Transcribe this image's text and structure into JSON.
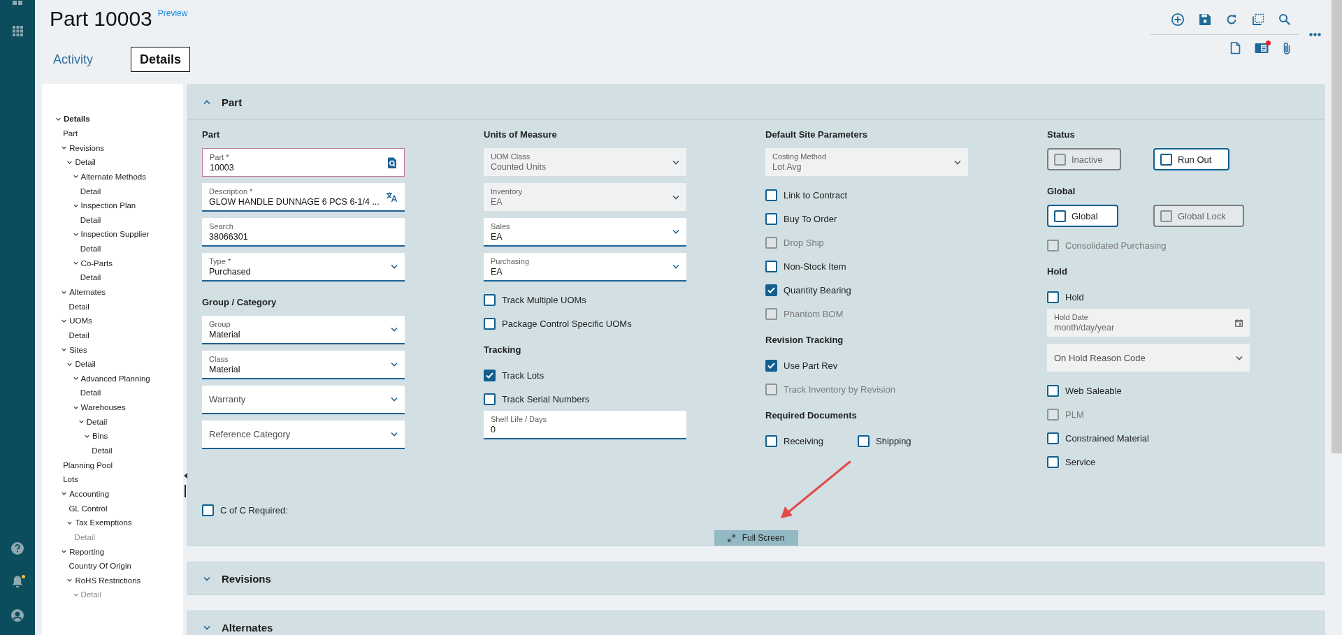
{
  "rail": {
    "unread": true
  },
  "header": {
    "title": "Part 10003",
    "preview_link": "Preview"
  },
  "tabs": [
    {
      "label": "Activity",
      "selected": false
    },
    {
      "label": "Details",
      "selected": true
    }
  ],
  "toolbar": {
    "badge": true
  },
  "tree": [
    {
      "label": "Details",
      "expanded": true,
      "disabled": false,
      "children": [
        {
          "label": "Part",
          "expanded": false,
          "disabled": false
        },
        {
          "label": "Revisions",
          "expanded": true,
          "disabled": false,
          "children": [
            {
              "label": "Detail",
              "expanded": true,
              "disabled": false,
              "children": [
                {
                  "label": "Alternate Methods",
                  "expanded": true,
                  "disabled": false,
                  "children": [
                    {
                      "label": "Detail",
                      "expanded": false,
                      "disabled": false
                    }
                  ]
                },
                {
                  "label": "Inspection Plan",
                  "expanded": true,
                  "disabled": false,
                  "children": [
                    {
                      "label": "Detail",
                      "expanded": false,
                      "disabled": false
                    }
                  ]
                },
                {
                  "label": "Inspection Supplier",
                  "expanded": true,
                  "disabled": false,
                  "children": [
                    {
                      "label": "Detail",
                      "expanded": false,
                      "disabled": false
                    }
                  ]
                },
                {
                  "label": "Co-Parts",
                  "expanded": true,
                  "disabled": false,
                  "children": [
                    {
                      "label": "Detail",
                      "expanded": false,
                      "disabled": false
                    }
                  ]
                }
              ]
            }
          ]
        },
        {
          "label": "Alternates",
          "expanded": true,
          "disabled": false,
          "children": [
            {
              "label": "Detail",
              "expanded": false,
              "disabled": false
            }
          ]
        },
        {
          "label": "UOMs",
          "expanded": true,
          "disabled": false,
          "children": [
            {
              "label": "Detail",
              "expanded": false,
              "disabled": false
            }
          ]
        },
        {
          "label": "Sites",
          "expanded": true,
          "disabled": false,
          "children": [
            {
              "label": "Detail",
              "expanded": true,
              "disabled": false,
              "children": [
                {
                  "label": "Advanced Planning",
                  "expanded": true,
                  "disabled": false,
                  "children": [
                    {
                      "label": "Detail",
                      "expanded": false,
                      "disabled": false
                    }
                  ]
                },
                {
                  "label": "Warehouses",
                  "expanded": true,
                  "disabled": false,
                  "children": [
                    {
                      "label": "Detail",
                      "expanded": true,
                      "disabled": false,
                      "children": [
                        {
                          "label": "Bins",
                          "expanded": true,
                          "disabled": false,
                          "children": [
                            {
                              "label": "Detail",
                              "expanded": false,
                              "disabled": false
                            }
                          ]
                        }
                      ]
                    }
                  ]
                }
              ]
            }
          ]
        },
        {
          "label": "Planning Pool",
          "expanded": false,
          "disabled": false
        },
        {
          "label": "Lots",
          "expanded": false,
          "disabled": false
        },
        {
          "label": "Accounting",
          "expanded": true,
          "disabled": false,
          "children": [
            {
              "label": "GL Control",
              "expanded": false,
              "disabled": false
            },
            {
              "label": "Tax Exemptions",
              "expanded": true,
              "disabled": false,
              "children": [
                {
                  "label": "Detail",
                  "expanded": false,
                  "disabled": true
                }
              ]
            }
          ]
        },
        {
          "label": "Reporting",
          "expanded": true,
          "disabled": false,
          "children": [
            {
              "label": "Country Of Origin",
              "expanded": false,
              "disabled": false
            },
            {
              "label": "RoHS Restrictions",
              "expanded": true,
              "disabled": false,
              "children": [
                {
                  "label": "Detail",
                  "expanded": true,
                  "disabled": true
                }
              ]
            }
          ]
        }
      ]
    }
  ],
  "part_section": {
    "title": "Part",
    "expanded": true,
    "columns": [
      {
        "items": [
          {
            "kind": "heading",
            "text": "Part"
          },
          {
            "kind": "lookup",
            "label": "Part *",
            "value": "10003",
            "focused": true
          },
          {
            "kind": "translatable",
            "label": "Description *",
            "value": "GLOW HANDLE DUNNAGE 6 PCS 6-1/4 ...",
            "focused": false
          },
          {
            "kind": "text",
            "label": "Search",
            "value": "38066301",
            "focused": false
          },
          {
            "kind": "select",
            "label": "Type *",
            "value": "Purchased",
            "disabled": false
          },
          {
            "kind": "heading",
            "text": "Group / Category"
          },
          {
            "kind": "select",
            "label": "Group",
            "value": "Material",
            "disabled": false
          },
          {
            "kind": "select",
            "label": "Class",
            "value": "Material",
            "disabled": false
          },
          {
            "kind": "select",
            "label": "Warranty",
            "disabled": false
          },
          {
            "kind": "select",
            "label": "Reference Category",
            "disabled": false
          }
        ]
      },
      {
        "items": [
          {
            "kind": "heading",
            "text": "Units of Measure"
          },
          {
            "kind": "select",
            "label": "UOM Class",
            "value": "Counted Units",
            "disabled": true
          },
          {
            "kind": "select",
            "label": "Inventory",
            "value": "EA",
            "disabled": true
          },
          {
            "kind": "select",
            "label": "Sales",
            "value": "EA",
            "disabled": false
          },
          {
            "kind": "select",
            "label": "Purchasing",
            "value": "EA",
            "disabled": false
          },
          {
            "kind": "checkbox",
            "label": "Track Multiple UOMs",
            "checked": false,
            "disabled": false
          },
          {
            "kind": "checkbox",
            "label": "Package Control Specific UOMs",
            "checked": false,
            "disabled": false
          },
          {
            "kind": "heading",
            "text": "Tracking"
          },
          {
            "kind": "checkbox",
            "label": "Track Lots",
            "checked": true,
            "disabled": false
          },
          {
            "kind": "checkbox",
            "label": "Track Serial Numbers",
            "checked": false,
            "disabled": false
          },
          {
            "kind": "text",
            "label": "Shelf Life / Days",
            "value": "0",
            "focused": false
          }
        ]
      },
      {
        "items": [
          {
            "kind": "heading",
            "text": "Default Site Parameters"
          },
          {
            "kind": "select",
            "label": "Costing Method",
            "value": "Lot Avg",
            "disabled": true
          },
          {
            "kind": "checkbox",
            "label": "Link to Contract",
            "checked": false,
            "disabled": false
          },
          {
            "kind": "checkbox",
            "label": "Buy To Order",
            "checked": false,
            "disabled": false
          },
          {
            "kind": "checkbox",
            "label": "Drop Ship",
            "checked": false,
            "disabled": true
          },
          {
            "kind": "checkbox",
            "label": "Non-Stock Item",
            "checked": false,
            "disabled": false
          },
          {
            "kind": "checkbox",
            "label": "Quantity Bearing",
            "checked": true,
            "disabled": false
          },
          {
            "kind": "checkbox",
            "label": "Phantom BOM",
            "checked": false,
            "disabled": true
          },
          {
            "kind": "heading",
            "text": "Revision Tracking"
          },
          {
            "kind": "checkbox",
            "label": "Use Part Rev",
            "checked": true,
            "disabled": false
          },
          {
            "kind": "checkbox",
            "label": "Track Inventory by Revision",
            "checked": false,
            "disabled": true
          },
          {
            "kind": "heading",
            "text": "Required Documents"
          },
          {
            "kind": "checkbox-row",
            "items": [
              {
                "label": "Receiving",
                "checked": false,
                "disabled": false
              },
              {
                "label": "Shipping",
                "checked": false,
                "disabled": false
              }
            ]
          }
        ]
      },
      {
        "items": [
          {
            "kind": "heading",
            "text": "Status"
          },
          {
            "kind": "toggles",
            "items": [
              {
                "label": "Inactive",
                "checked": false,
                "disabled": true
              },
              {
                "label": "Run Out",
                "checked": false,
                "disabled": false
              }
            ]
          },
          {
            "kind": "heading",
            "text": "Global"
          },
          {
            "kind": "toggles",
            "items": [
              {
                "label": "Global",
                "checked": false,
                "disabled": false
              },
              {
                "label": "Global Lock",
                "checked": false,
                "disabled": true
              }
            ]
          },
          {
            "kind": "checkbox",
            "label": "Consolidated Purchasing",
            "checked": false,
            "disabled": true
          },
          {
            "kind": "heading",
            "text": "Hold"
          },
          {
            "kind": "checkbox",
            "label": "Hold",
            "checked": false,
            "disabled": false
          },
          {
            "kind": "date",
            "label": "Hold Date",
            "placeholder": "month/day/year",
            "disabled": true
          },
          {
            "kind": "select",
            "label": "On Hold Reason Code",
            "disabled": true
          },
          {
            "kind": "checkbox",
            "label": "Web Saleable",
            "checked": false,
            "disabled": false
          },
          {
            "kind": "checkbox",
            "label": "PLM",
            "checked": false,
            "disabled": true
          },
          {
            "kind": "checkbox",
            "label": "Constrained Material",
            "checked": false,
            "disabled": false
          },
          {
            "kind": "checkbox",
            "label": "Service",
            "checked": false,
            "disabled": false
          }
        ]
      }
    ],
    "footer": {
      "label": "C of C Required:",
      "checked": false,
      "disabled": false
    },
    "full_screen_button": "Full Screen"
  },
  "sections": [
    {
      "title": "Revisions",
      "expanded": false
    },
    {
      "title": "Alternates",
      "expanded": false
    }
  ]
}
